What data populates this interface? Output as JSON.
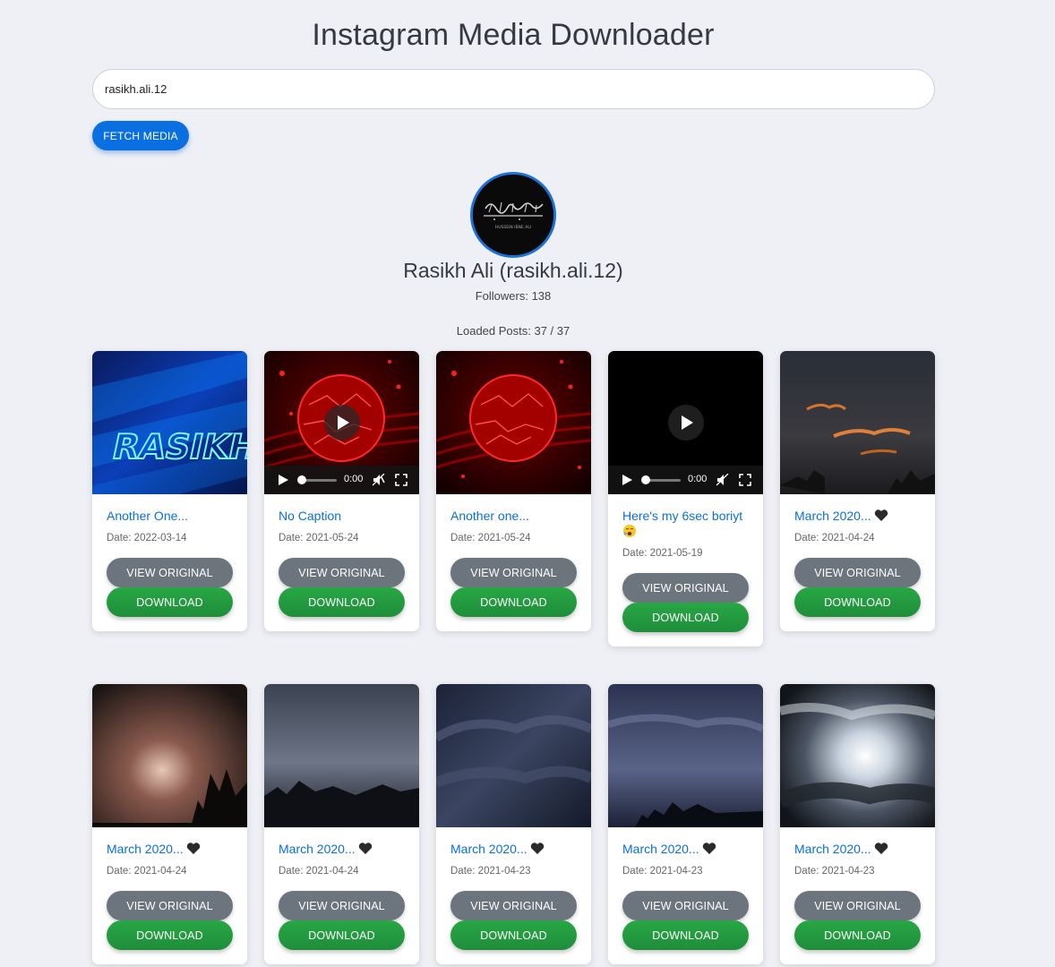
{
  "app": {
    "title": "Instagram Media Downloader"
  },
  "search": {
    "value": "rasikh.ali.12",
    "button_label": "FETCH MEDIA"
  },
  "profile": {
    "name": "Rasikh Ali (rasikh.ali.12)",
    "followers_text": "Followers: 138",
    "avatar_caption": "HUSSEIN IBNE ALI"
  },
  "loaded_text": "Loaded Posts: 37 / 37",
  "buttons": {
    "view": "VIEW ORIGINAL",
    "download": "DOWNLOAD"
  },
  "posts": [
    {
      "caption": "Another One...",
      "date": "Date: 2022-03-14",
      "media": "image",
      "thumb": "neon-rasikh"
    },
    {
      "caption": "No Caption",
      "date": "Date: 2021-05-24",
      "media": "video",
      "thumb": "red-sphere",
      "time": "0:00"
    },
    {
      "caption": "Another one...",
      "date": "Date: 2021-05-24",
      "media": "image",
      "thumb": "red-sphere"
    },
    {
      "caption": "Here's my 6sec boriyt",
      "emoji": "yawning-face-emoji",
      "date": "Date: 2021-05-19",
      "media": "video",
      "thumb": "black",
      "time": "0:00"
    },
    {
      "caption": "March 2020...",
      "emoji": "black-heart-emoji",
      "date": "Date: 2021-04-24",
      "media": "image",
      "thumb": "sunset-clouds"
    },
    {
      "caption": "March 2020...",
      "emoji": "black-heart-emoji",
      "date": "Date: 2021-04-24",
      "media": "image",
      "thumb": "sun-through-clouds"
    },
    {
      "caption": "March 2020...",
      "emoji": "black-heart-emoji",
      "date": "Date: 2021-04-24",
      "media": "image",
      "thumb": "dusk-trees"
    },
    {
      "caption": "March 2020...",
      "emoji": "black-heart-emoji",
      "date": "Date: 2021-04-23",
      "media": "image",
      "thumb": "storm-clouds"
    },
    {
      "caption": "March 2020...",
      "emoji": "black-heart-emoji",
      "date": "Date: 2021-04-23",
      "media": "image",
      "thumb": "purple-sky-trees"
    },
    {
      "caption": "March 2020...",
      "emoji": "black-heart-emoji",
      "date": "Date: 2021-04-23",
      "media": "image",
      "thumb": "sunburst-clouds"
    }
  ],
  "colors": {
    "accent": "#0a6fe0",
    "view_button": "#6c757d",
    "download_button": "#28a745",
    "background": "#eef0f5"
  }
}
